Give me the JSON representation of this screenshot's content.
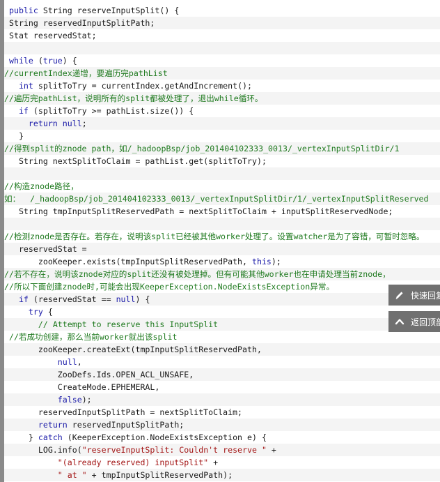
{
  "code": {
    "lines": [
      [
        {
          "t": " "
        },
        {
          "t": "public",
          "c": "kw"
        },
        {
          "t": " String reserveInputSplit() {"
        }
      ],
      [
        {
          "t": " String reservedInputSplitPath;"
        }
      ],
      [
        {
          "t": " Stat reservedStat;"
        }
      ],
      [
        {
          "t": ""
        }
      ],
      [
        {
          "t": " "
        },
        {
          "t": "while",
          "c": "kw"
        },
        {
          "t": " ("
        },
        {
          "t": "true",
          "c": "kw"
        },
        {
          "t": ") {"
        }
      ],
      [
        {
          "t": "//currentIndex递增，要遍历完pathList",
          "c": "cm"
        }
      ],
      [
        {
          "t": "   "
        },
        {
          "t": "int",
          "c": "kw"
        },
        {
          "t": " splitToTry = currentIndex.getAndIncrement();"
        }
      ],
      [
        {
          "t": "//遍历完pathList，说明所有的split都被处理了，退出while循环。",
          "c": "cm"
        }
      ],
      [
        {
          "t": "   "
        },
        {
          "t": "if",
          "c": "kw"
        },
        {
          "t": " (splitToTry >= pathList.size()) {"
        }
      ],
      [
        {
          "t": "     "
        },
        {
          "t": "return",
          "c": "kw"
        },
        {
          "t": " "
        },
        {
          "t": "null",
          "c": "kw"
        },
        {
          "t": ";"
        }
      ],
      [
        {
          "t": "   }"
        }
      ],
      [
        {
          "t": "//得到split的znode path，如/_hadoopBsp/job_201404102333_0013/_vertexInputSplitDir/1",
          "c": "cm"
        }
      ],
      [
        {
          "t": "   String nextSplitToClaim = pathList.get(splitToTry);"
        }
      ],
      [
        {
          "t": ""
        }
      ],
      [
        {
          "t": "//构造znode路径，",
          "c": "cm"
        }
      ],
      [
        {
          "t": "如：  /_hadoopBsp/job_201404102333_0013/_vertexInputSplitDir/1/_vertexInputSplitReserved",
          "c": "cm"
        }
      ],
      [
        {
          "t": "   String tmpInputSplitReservedPath = nextSplitToClaim + inputSplitReservedNode;"
        }
      ],
      [
        {
          "t": ""
        }
      ],
      [
        {
          "t": "//检测znode是否存在。若存在，说明该split已经被其他worker处理了。设置watcher是为了容错，可暂时忽略。",
          "c": "cm"
        }
      ],
      [
        {
          "t": "   reservedStat ="
        }
      ],
      [
        {
          "t": "       zooKeeper.exists(tmpInputSplitReservedPath, "
        },
        {
          "t": "this",
          "c": "kw"
        },
        {
          "t": ");"
        }
      ],
      [
        {
          "t": "//若不存在，说明该znode对应的split还没有被处理掉。但有可能其他worker也在申请处理当前znode，",
          "c": "cm"
        }
      ],
      [
        {
          "t": "//所以下面创建znode时,可能会出现KeeperException.NodeExistsException异常。",
          "c": "cm"
        }
      ],
      [
        {
          "t": "   "
        },
        {
          "t": "if",
          "c": "kw"
        },
        {
          "t": " (reservedStat == "
        },
        {
          "t": "null",
          "c": "kw"
        },
        {
          "t": ") {"
        }
      ],
      [
        {
          "t": "     "
        },
        {
          "t": "try",
          "c": "kw"
        },
        {
          "t": " {"
        }
      ],
      [
        {
          "t": "       "
        },
        {
          "t": "// Attempt to reserve this InputSplit",
          "c": "cm"
        }
      ],
      [
        {
          "t": " "
        },
        {
          "t": "//若成功创建，那么当前worker就出该split",
          "c": "cm"
        }
      ],
      [
        {
          "t": "       zooKeeper.createExt(tmpInputSplitReservedPath,"
        }
      ],
      [
        {
          "t": "           "
        },
        {
          "t": "null",
          "c": "kw"
        },
        {
          "t": ","
        }
      ],
      [
        {
          "t": "           ZooDefs.Ids.OPEN_ACL_UNSAFE,"
        }
      ],
      [
        {
          "t": "           CreateMode.EPHEMERAL,"
        }
      ],
      [
        {
          "t": "           "
        },
        {
          "t": "false",
          "c": "kw"
        },
        {
          "t": ");"
        }
      ],
      [
        {
          "t": "       reservedInputSplitPath = nextSplitToClaim;"
        }
      ],
      [
        {
          "t": "       "
        },
        {
          "t": "return",
          "c": "kw"
        },
        {
          "t": " reservedInputSplitPath;"
        }
      ],
      [
        {
          "t": "     } "
        },
        {
          "t": "catch",
          "c": "kw"
        },
        {
          "t": " (KeeperException.NodeExistsException e) {"
        }
      ],
      [
        {
          "t": "       LOG.info("
        },
        {
          "t": "\"reserveInputSplit: Couldn't reserve \"",
          "c": "st"
        },
        {
          "t": " +"
        }
      ],
      [
        {
          "t": "           "
        },
        {
          "t": "\"(already reserved) inputSplit\"",
          "c": "st"
        },
        {
          "t": " +"
        }
      ],
      [
        {
          "t": "           "
        },
        {
          "t": "\" at \"",
          "c": "st"
        },
        {
          "t": " + tmpInputSplitReservedPath);"
        }
      ]
    ]
  },
  "float_buttons": {
    "quick_reply": {
      "label": "快速回复",
      "icon": "pencil-icon"
    },
    "back_top": {
      "label": "返回顶部",
      "icon": "chevron-up-icon"
    }
  },
  "colors": {
    "keyword": "#1a1aa8",
    "comment": "#1f7a1f",
    "string": "#a31515",
    "alt_row": "#f4f4f4",
    "gutter": "#8a8a8a",
    "float_button_bg": "#707070"
  }
}
